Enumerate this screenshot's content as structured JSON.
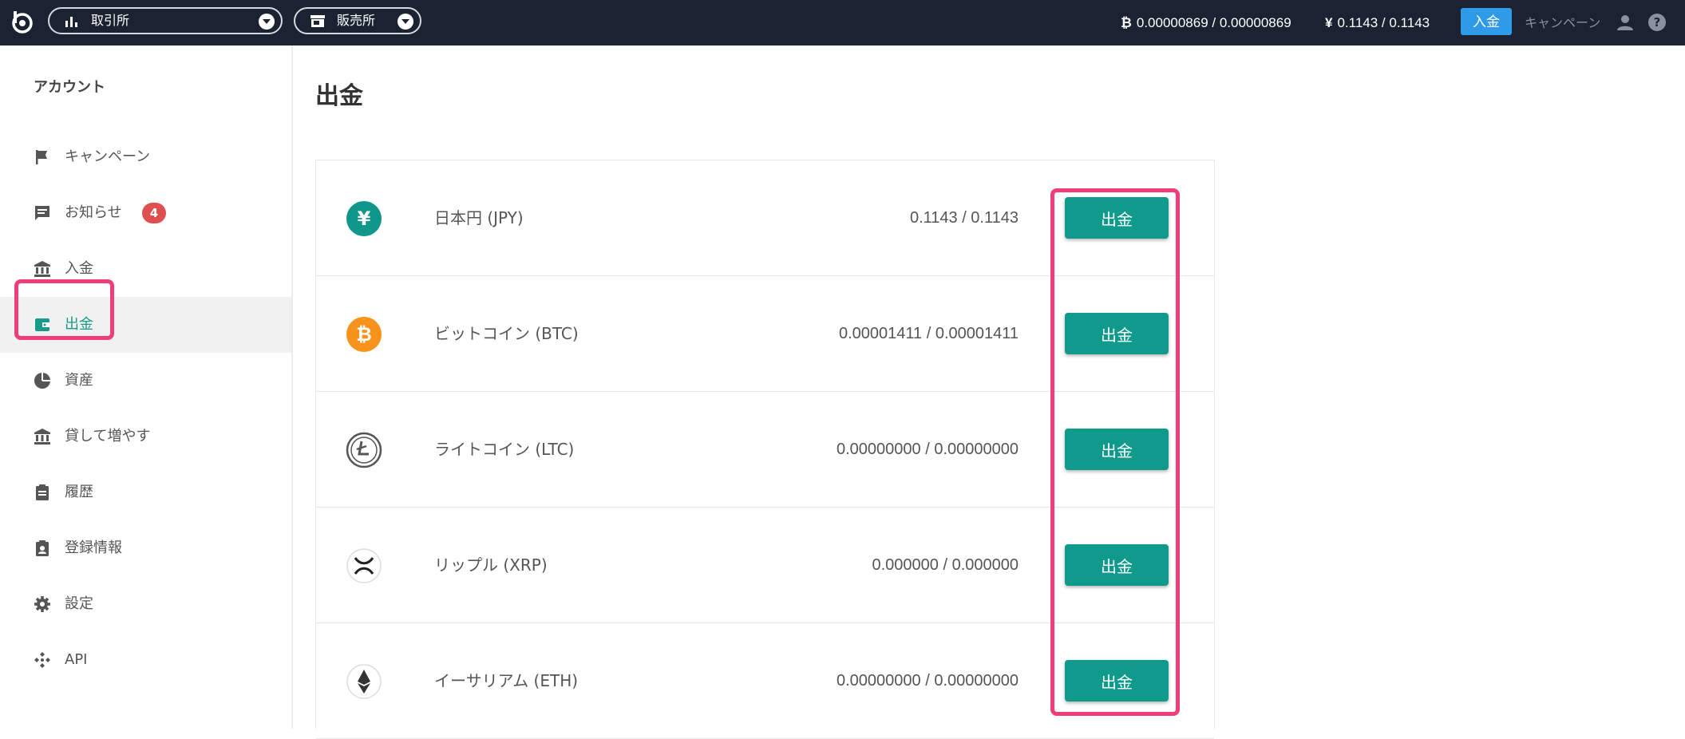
{
  "header": {
    "exchange_label": "取引所",
    "store_label": "販売所",
    "btc_symbol": "₿",
    "btc_balance": "0.00000869 / 0.00000869",
    "jpy_symbol": "¥",
    "jpy_balance": "0.1143 / 0.1143",
    "deposit_label": "入金",
    "campaign_label": "キャンペーン"
  },
  "sidebar": {
    "heading": "アカウント",
    "items": [
      {
        "label": "キャンペーン",
        "icon": "flag-icon"
      },
      {
        "label": "お知らせ",
        "icon": "message-icon",
        "badge": "4"
      },
      {
        "label": "入金",
        "icon": "bank-icon"
      },
      {
        "label": "出金",
        "icon": "wallet-icon",
        "active": true
      },
      {
        "label": "資産",
        "icon": "pie-chart-icon"
      },
      {
        "label": "貸して増やす",
        "icon": "bank-icon"
      },
      {
        "label": "履歴",
        "icon": "clipboard-icon"
      },
      {
        "label": "登録情報",
        "icon": "profile-icon"
      },
      {
        "label": "設定",
        "icon": "gear-icon"
      },
      {
        "label": "API",
        "icon": "api-icon"
      }
    ]
  },
  "main": {
    "title": "出金",
    "coins": [
      {
        "name": "日本円 (JPY)",
        "balance": "0.1143 / 0.1143",
        "button": "出金",
        "icon": "yen-icon"
      },
      {
        "name": "ビットコイン (BTC)",
        "balance": "0.00001411 / 0.00001411",
        "button": "出金",
        "icon": "bitcoin-icon"
      },
      {
        "name": "ライトコイン (LTC)",
        "balance": "0.00000000 / 0.00000000",
        "button": "出金",
        "icon": "litecoin-icon"
      },
      {
        "name": "リップル (XRP)",
        "balance": "0.000000 / 0.000000",
        "button": "出金",
        "icon": "ripple-icon"
      },
      {
        "name": "イーサリアム (ETH)",
        "balance": "0.00000000 / 0.00000000",
        "button": "出金",
        "icon": "ethereum-icon"
      }
    ]
  },
  "colors": {
    "topbar": "#1b2231",
    "accent": "#109a8c",
    "deposit": "#2f9be8",
    "highlight": "#f03c7a",
    "badge": "#e04f4f"
  }
}
